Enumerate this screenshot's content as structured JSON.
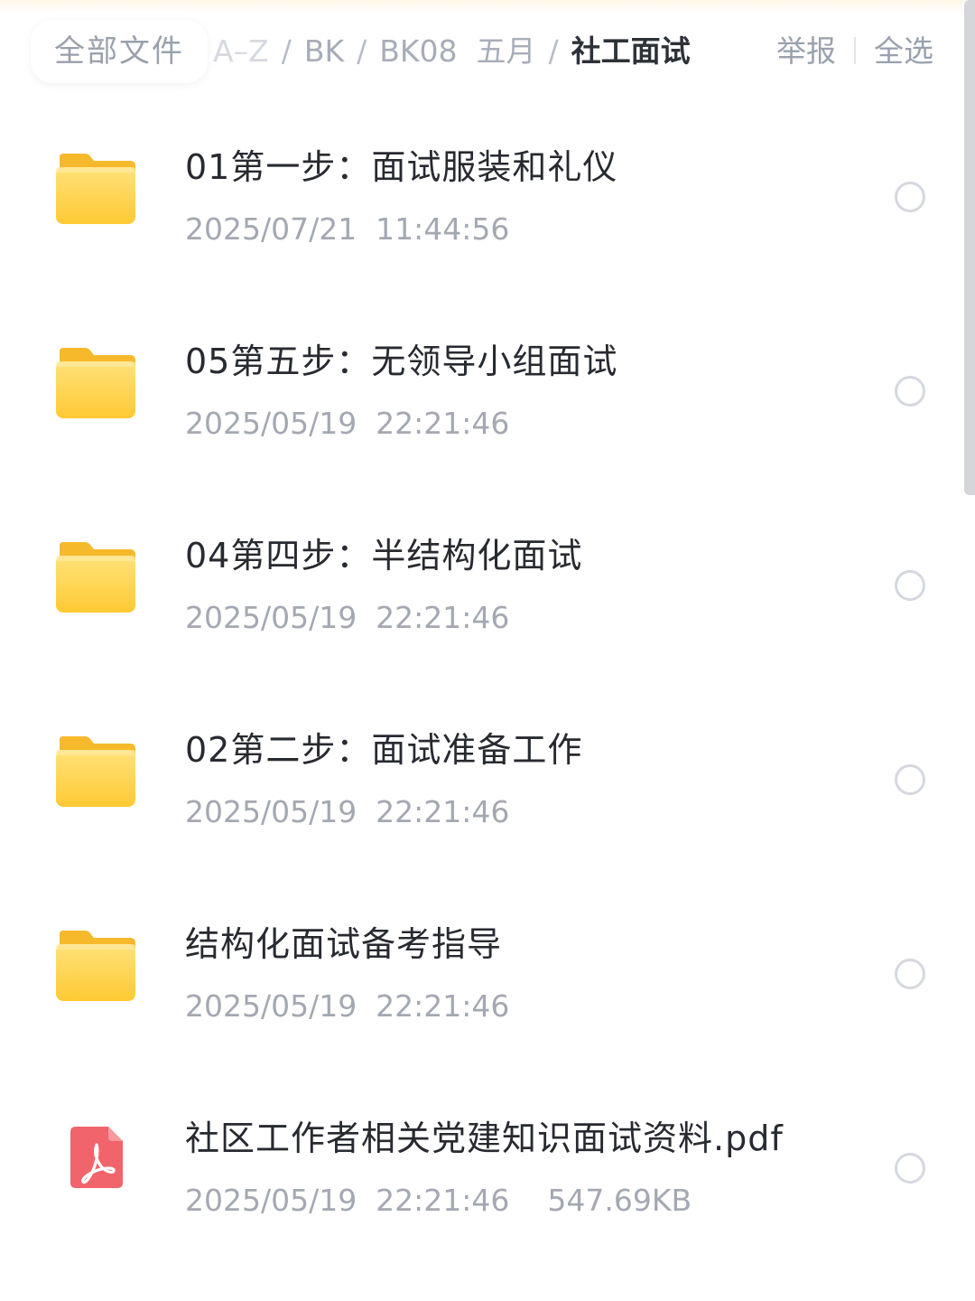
{
  "header": {
    "all_files_label": "全部文件",
    "breadcrumb": [
      "A–Z",
      "BK",
      "BK08  五月",
      "社工面试"
    ],
    "report_label": "举报",
    "select_all_label": "全选"
  },
  "colors": {
    "folder_yellow": "#FFD34E",
    "pdf_red": "#F2646B",
    "muted_text": "#A3A8B2"
  },
  "files": [
    {
      "type": "folder",
      "icon": "folder-icon",
      "name": "01第一步：面试服装和礼仪",
      "date": "2025/07/21  11:44:56",
      "size": ""
    },
    {
      "type": "folder",
      "icon": "folder-icon",
      "name": "05第五步：无领导小组面试",
      "date": "2025/05/19  22:21:46",
      "size": ""
    },
    {
      "type": "folder",
      "icon": "folder-icon",
      "name": "04第四步：半结构化面试",
      "date": "2025/05/19  22:21:46",
      "size": ""
    },
    {
      "type": "folder",
      "icon": "folder-icon",
      "name": "02第二步：面试准备工作",
      "date": "2025/05/19  22:21:46",
      "size": ""
    },
    {
      "type": "folder",
      "icon": "folder-icon",
      "name": "结构化面试备考指导",
      "date": "2025/05/19  22:21:46",
      "size": ""
    },
    {
      "type": "pdf",
      "icon": "pdf-file-icon",
      "name": "社区工作者相关党建知识面试资料.pdf",
      "date": "2025/05/19  22:21:46",
      "size": "547.69KB"
    }
  ]
}
